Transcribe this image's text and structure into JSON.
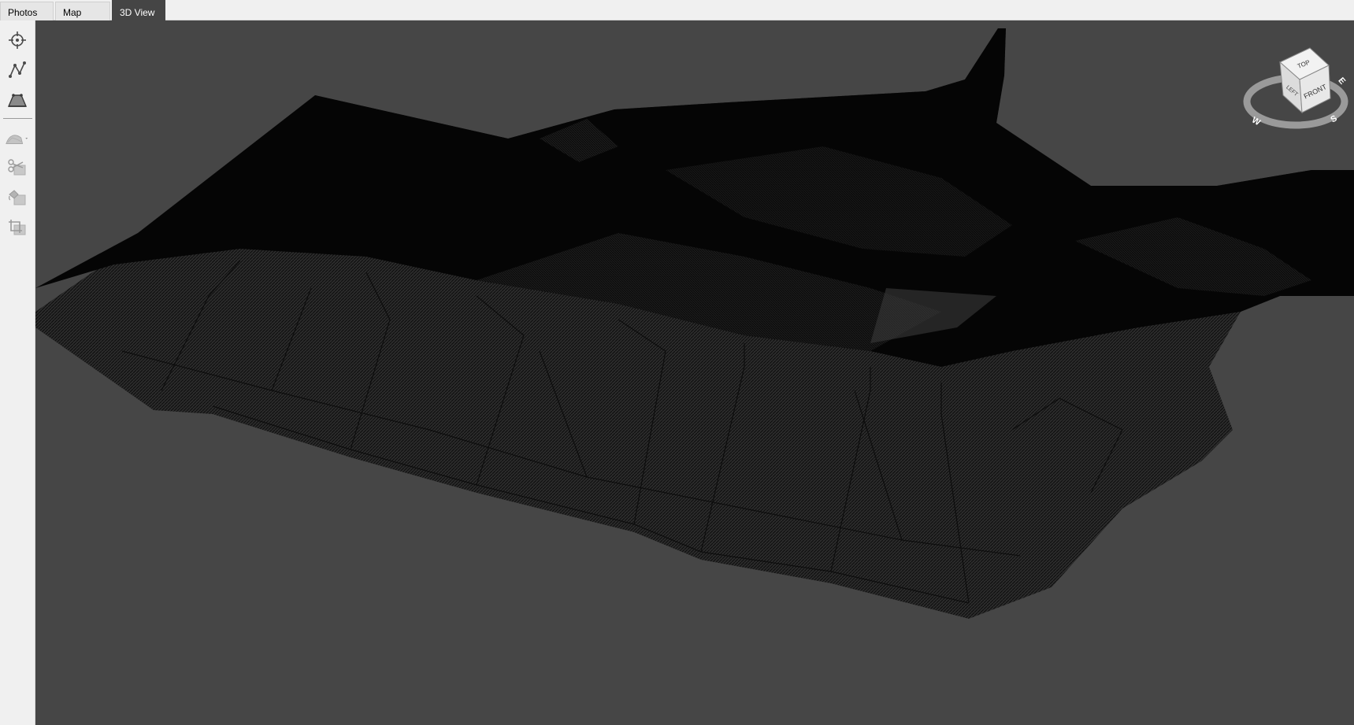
{
  "tabs": [
    {
      "label": "Photos",
      "active": false
    },
    {
      "label": "Map",
      "active": false
    },
    {
      "label": "3D View",
      "active": true
    }
  ],
  "toolbar": {
    "tools": [
      {
        "icon": "crosshair-icon",
        "enabled": true
      },
      {
        "icon": "polyline-icon",
        "enabled": true
      },
      {
        "icon": "volume-icon",
        "enabled": true
      },
      {
        "icon": "surface-dropdown-icon",
        "enabled": false
      },
      {
        "icon": "cut-mesh-icon",
        "enabled": false
      },
      {
        "icon": "fill-mesh-icon",
        "enabled": false
      },
      {
        "icon": "crop-mesh-icon",
        "enabled": false
      }
    ]
  },
  "viewport": {
    "background": "#464646",
    "mesh_color": "#0a0a0a"
  },
  "navcube": {
    "top": "TOP",
    "front": "FRONT",
    "left": "LEFT",
    "compass_e": "E",
    "compass_s": "S",
    "compass_w": "W"
  }
}
